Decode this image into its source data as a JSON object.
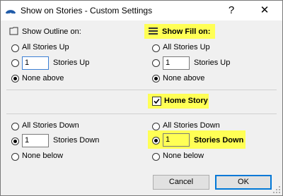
{
  "window": {
    "title": "Show on Stories - Custom Settings",
    "help": "?",
    "close": "✕"
  },
  "outline": {
    "heading": "Show Outline on:",
    "all_up": "All Stories Up",
    "up_value": "1",
    "up_label": "Stories Up",
    "none_above": "None above",
    "all_down": "All Stories Down",
    "down_value": "1",
    "down_label": "Stories Down",
    "none_below": "None below"
  },
  "fill": {
    "heading": "Show Fill on:",
    "all_up": "All Stories Up",
    "up_value": "1",
    "up_label": "Stories Up",
    "none_above": "None above",
    "all_down": "All Stories Down",
    "down_value": "1",
    "down_label": "Stories Down",
    "none_below": "None below"
  },
  "home_story": {
    "label": "Home Story",
    "checked": true
  },
  "buttons": {
    "cancel": "Cancel",
    "ok": "OK"
  },
  "colors": {
    "highlight": "#ffff55",
    "focus_border": "#3c7fd4",
    "accent": "#0078d7"
  }
}
